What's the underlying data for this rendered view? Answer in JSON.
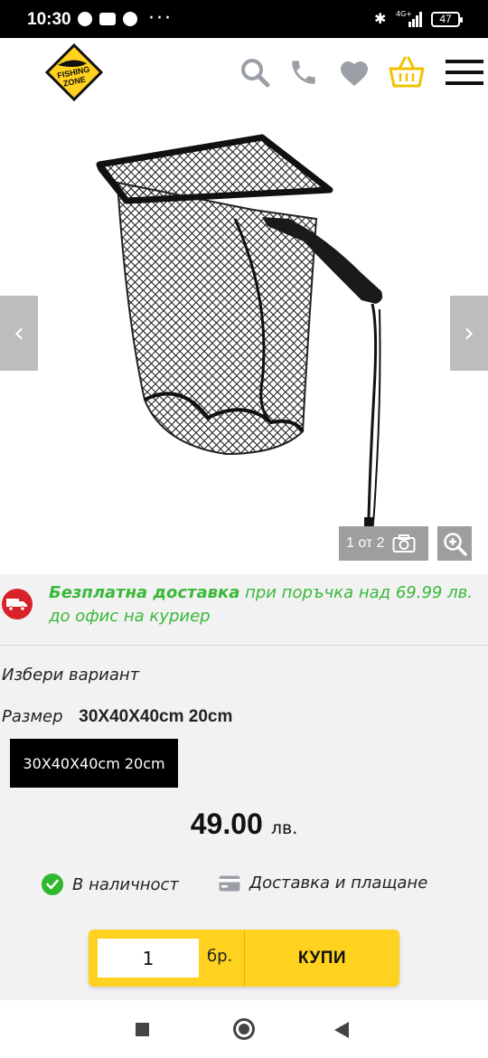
{
  "status_bar": {
    "time": "10:30",
    "dots": "···",
    "network": "4G+",
    "battery": "47"
  },
  "header": {
    "logo_text": "FISHING ZONE",
    "icons": [
      "search-icon",
      "phone-icon",
      "heart-icon",
      "basket-icon",
      "menu-icon"
    ],
    "colors": {
      "icon": "#9aa0a6",
      "basket": "#f2c200",
      "logo": "#ffd21f"
    }
  },
  "gallery": {
    "counter": "1 от 2",
    "prev": "‹",
    "next": "›"
  },
  "delivery": {
    "bold": "Безплатна доставка",
    "rest": " при поръчка над 69.99 лв. до офис на куриер",
    "color": "#3ab83a"
  },
  "variant": {
    "choose_label": "Избери вариант",
    "size_label": "Размер",
    "size_value": "30X40X40cm 20cm",
    "option_label": "30X40X40cm 20cm"
  },
  "price": {
    "amount": "49.00",
    "currency": "лв."
  },
  "availability": {
    "in_stock": "В наличност",
    "shipping": "Доставка и плащане"
  },
  "buy": {
    "quantity": "1",
    "unit": "бр.",
    "button": "КУПИ"
  }
}
